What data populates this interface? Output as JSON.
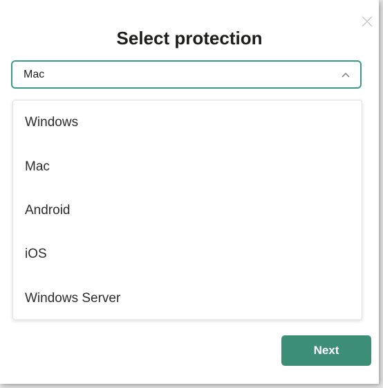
{
  "dialog": {
    "title": "Select protection",
    "close_icon": "close-icon"
  },
  "select": {
    "value": "Mac",
    "chevron_icon": "chevron-up-icon",
    "border_color": "#3b9a85"
  },
  "dropdown": {
    "options": [
      {
        "label": "Windows"
      },
      {
        "label": "Mac"
      },
      {
        "label": "Android"
      },
      {
        "label": "iOS"
      },
      {
        "label": "Windows Server"
      }
    ]
  },
  "footer": {
    "next_label": "Next",
    "button_color": "#3d8e76"
  }
}
